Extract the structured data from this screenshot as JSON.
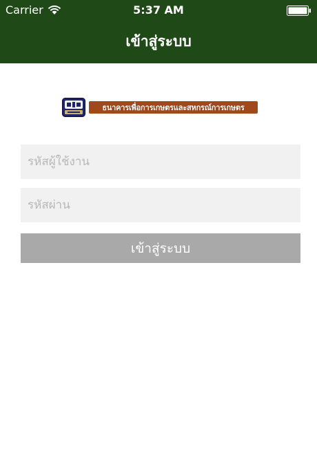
{
  "status_bar": {
    "carrier": "Carrier",
    "time": "5:37 AM"
  },
  "nav": {
    "title": "เข้าสู่ระบบ"
  },
  "logo": {
    "text": "ธนาคารเพื่อการเกษตรและสหกรณ์การเกษตร"
  },
  "form": {
    "username_placeholder": "รหัสผู้ใช้งาน",
    "password_placeholder": "รหัสผ่าน",
    "login_label": "เข้าสู่ระบบ"
  },
  "colors": {
    "header": "#1f4a17",
    "field_bg": "#f1f1f1",
    "button_bg": "#a9a9a9",
    "cursor": "#2b6fe0"
  }
}
